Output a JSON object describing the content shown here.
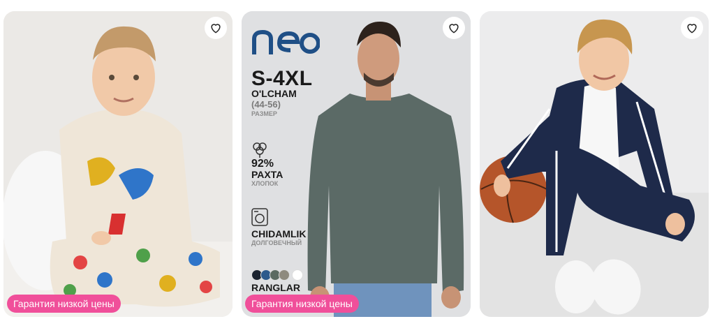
{
  "products": [
    {
      "image_alt": "kids-pajamas-dinosaur",
      "badge": "Гарантия низкой цены"
    },
    {
      "brand": "neo",
      "size_range": "S-4XL",
      "size_label_uz": "O'LCHAM",
      "size_numbers": "(44-56)",
      "size_label_ru": "РАЗМЕР",
      "cotton_percent": "92%",
      "cotton_label_uz": "PAXTA",
      "cotton_label_ru": "ХЛОПОК",
      "durability_uz": "CHIDAMLIK",
      "durability_ru": "ДОЛГОВЕЧНЫЙ",
      "colors_label": "RANGLAR",
      "swatch_colors": [
        "#1c2430",
        "#2d5a8c",
        "#5b6a62",
        "#8e8a7e",
        "#ffffff"
      ],
      "badge": "Гарантия низкой цены"
    },
    {
      "image_alt": "kids-tracksuit-navy"
    }
  ],
  "icons": {
    "favorite": "heart-outline-icon"
  },
  "colors": {
    "badge": "#f04f9a",
    "brand_blue": "#1f4f86"
  }
}
